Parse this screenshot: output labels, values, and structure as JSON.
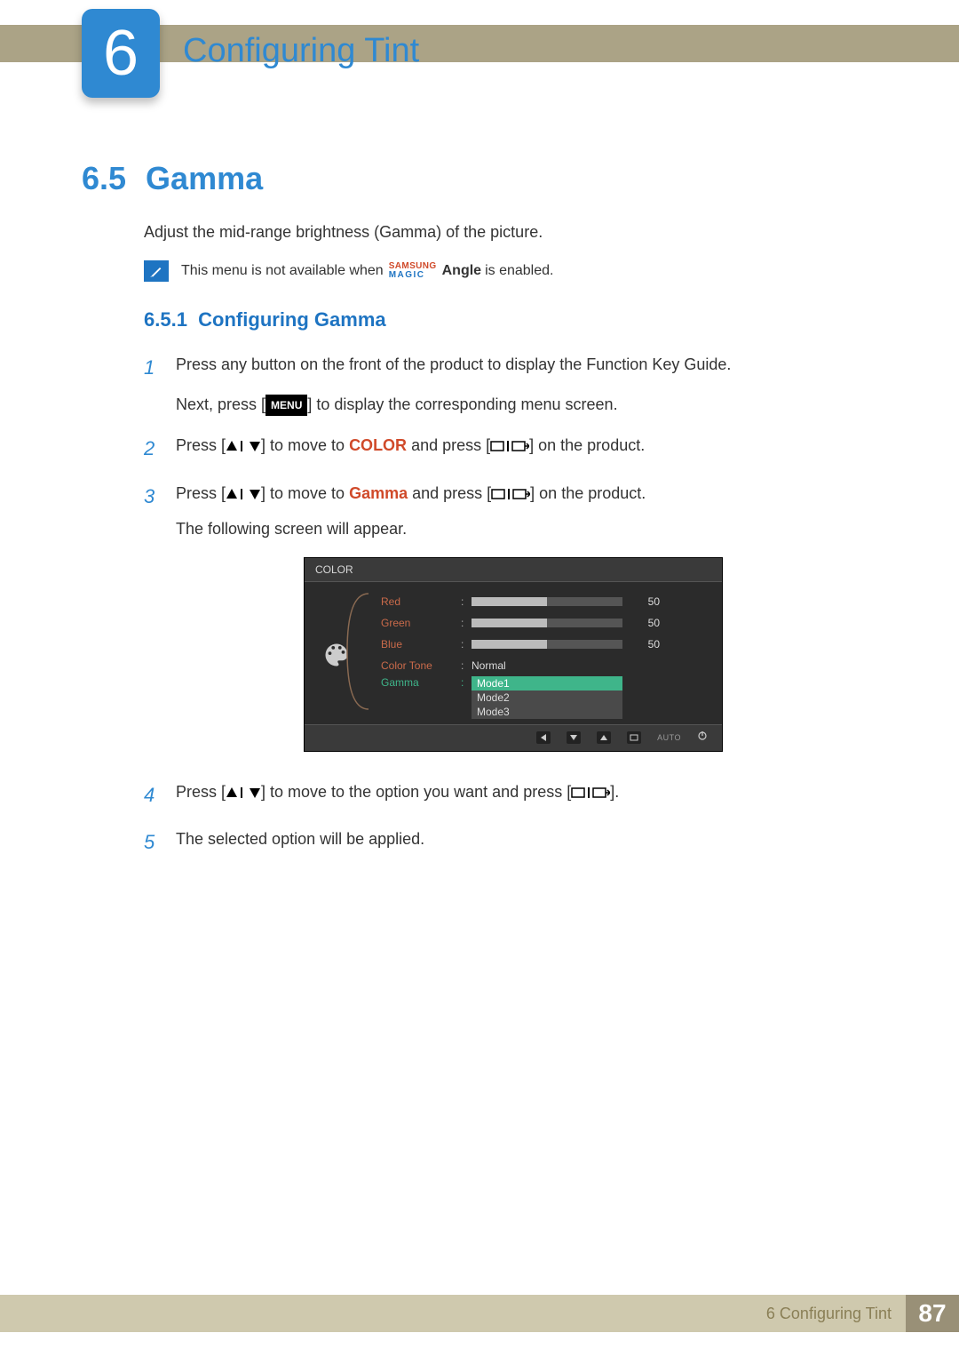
{
  "chapter": {
    "number": "6",
    "title": "Configuring Tint"
  },
  "section": {
    "number": "6.5",
    "title": "Gamma"
  },
  "intro": "Adjust the mid-range brightness (Gamma) of the picture.",
  "note": {
    "prefix": "This menu is not available when ",
    "brand_top": "SAMSUNG",
    "brand_bottom": "MAGIC",
    "brand_suffix": "Angle",
    "suffix": " is enabled."
  },
  "subsection": {
    "number": "6.5.1",
    "title": "Configuring Gamma"
  },
  "steps": {
    "s1": {
      "num": "1",
      "line1": "Press any button on the front of the product to display the Function Key Guide.",
      "line2a": "Next, press [",
      "menu_label": "MENU",
      "line2b": "] to display the corresponding menu screen."
    },
    "s2": {
      "num": "2",
      "pre": "Press [",
      "mid": "] to move to ",
      "keyword": "COLOR",
      "post": " and press [",
      "end": "] on the product."
    },
    "s3": {
      "num": "3",
      "pre": "Press [",
      "mid": "] to move to ",
      "keyword": "Gamma",
      "post": " and press [",
      "end": "] on the product.",
      "tail": "The following screen will appear."
    },
    "s4": {
      "num": "4",
      "pre": "Press [",
      "mid": "] to move to the option you want and press [",
      "end": "]."
    },
    "s5": {
      "num": "5",
      "text": "The selected option will be applied."
    }
  },
  "osd": {
    "title": "COLOR",
    "rows": {
      "red": {
        "label": "Red",
        "value": "50",
        "fill": 50
      },
      "green": {
        "label": "Green",
        "value": "50",
        "fill": 50
      },
      "blue": {
        "label": "Blue",
        "value": "50",
        "fill": 50
      },
      "tone": {
        "label": "Color Tone",
        "value": "Normal"
      },
      "gamma": {
        "label": "Gamma",
        "options": {
          "o1": "Mode1",
          "o2": "Mode2",
          "o3": "Mode3"
        }
      }
    },
    "footer": {
      "auto": "AUTO"
    }
  },
  "footer": {
    "label": "6 Configuring Tint",
    "page": "87"
  }
}
